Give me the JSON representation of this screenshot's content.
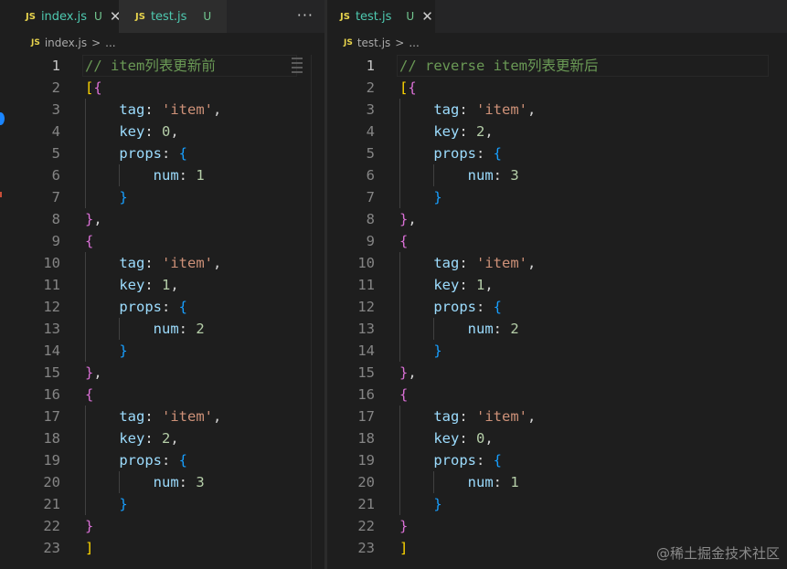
{
  "left": {
    "tabs": [
      {
        "icon": "JS",
        "name": "index.js",
        "status": "U",
        "close": "✕"
      },
      {
        "icon": "JS",
        "name": "test.js",
        "status": "U"
      }
    ],
    "more": "···",
    "breadcrumb": {
      "icon": "JS",
      "file": "index.js",
      "sep": ">",
      "rest": "..."
    },
    "lines": [
      [
        [
          "c-comment",
          "// item列表更新前"
        ]
      ],
      [
        [
          "c-b1",
          "["
        ],
        [
          "c-b2",
          "{"
        ]
      ],
      [
        [
          "c-punc",
          "    "
        ],
        [
          "c-key",
          "tag"
        ],
        [
          "c-punc",
          ": "
        ],
        [
          "c-str",
          "'item'"
        ],
        [
          "c-punc",
          ","
        ]
      ],
      [
        [
          "c-punc",
          "    "
        ],
        [
          "c-key",
          "key"
        ],
        [
          "c-punc",
          ": "
        ],
        [
          "c-num",
          "0"
        ],
        [
          "c-punc",
          ","
        ]
      ],
      [
        [
          "c-punc",
          "    "
        ],
        [
          "c-key",
          "props"
        ],
        [
          "c-punc",
          ": "
        ],
        [
          "c-b3",
          "{"
        ]
      ],
      [
        [
          "c-punc",
          "        "
        ],
        [
          "c-key",
          "num"
        ],
        [
          "c-punc",
          ": "
        ],
        [
          "c-num",
          "1"
        ]
      ],
      [
        [
          "c-punc",
          "    "
        ],
        [
          "c-b3",
          "}"
        ]
      ],
      [
        [
          "c-b2",
          "}"
        ],
        [
          "c-punc",
          ","
        ]
      ],
      [
        [
          "c-b2",
          "{"
        ]
      ],
      [
        [
          "c-punc",
          "    "
        ],
        [
          "c-key",
          "tag"
        ],
        [
          "c-punc",
          ": "
        ],
        [
          "c-str",
          "'item'"
        ],
        [
          "c-punc",
          ","
        ]
      ],
      [
        [
          "c-punc",
          "    "
        ],
        [
          "c-key",
          "key"
        ],
        [
          "c-punc",
          ": "
        ],
        [
          "c-num",
          "1"
        ],
        [
          "c-punc",
          ","
        ]
      ],
      [
        [
          "c-punc",
          "    "
        ],
        [
          "c-key",
          "props"
        ],
        [
          "c-punc",
          ": "
        ],
        [
          "c-b3",
          "{"
        ]
      ],
      [
        [
          "c-punc",
          "        "
        ],
        [
          "c-key",
          "num"
        ],
        [
          "c-punc",
          ": "
        ],
        [
          "c-num",
          "2"
        ]
      ],
      [
        [
          "c-punc",
          "    "
        ],
        [
          "c-b3",
          "}"
        ]
      ],
      [
        [
          "c-b2",
          "}"
        ],
        [
          "c-punc",
          ","
        ]
      ],
      [
        [
          "c-b2",
          "{"
        ]
      ],
      [
        [
          "c-punc",
          "    "
        ],
        [
          "c-key",
          "tag"
        ],
        [
          "c-punc",
          ": "
        ],
        [
          "c-str",
          "'item'"
        ],
        [
          "c-punc",
          ","
        ]
      ],
      [
        [
          "c-punc",
          "    "
        ],
        [
          "c-key",
          "key"
        ],
        [
          "c-punc",
          ": "
        ],
        [
          "c-num",
          "2"
        ],
        [
          "c-punc",
          ","
        ]
      ],
      [
        [
          "c-punc",
          "    "
        ],
        [
          "c-key",
          "props"
        ],
        [
          "c-punc",
          ": "
        ],
        [
          "c-b3",
          "{"
        ]
      ],
      [
        [
          "c-punc",
          "        "
        ],
        [
          "c-key",
          "num"
        ],
        [
          "c-punc",
          ": "
        ],
        [
          "c-num",
          "3"
        ]
      ],
      [
        [
          "c-punc",
          "    "
        ],
        [
          "c-b3",
          "}"
        ]
      ],
      [
        [
          "c-b2",
          "}"
        ]
      ],
      [
        [
          "c-b1",
          "]"
        ]
      ]
    ]
  },
  "right": {
    "tabs": [
      {
        "icon": "JS",
        "name": "test.js",
        "status": "U",
        "close": "✕"
      }
    ],
    "breadcrumb": {
      "icon": "JS",
      "file": "test.js",
      "sep": ">",
      "rest": "..."
    },
    "lines": [
      [
        [
          "c-comment",
          "// reverse item列表更新后"
        ]
      ],
      [
        [
          "c-b1",
          "["
        ],
        [
          "c-b2",
          "{"
        ]
      ],
      [
        [
          "c-punc",
          "    "
        ],
        [
          "c-key",
          "tag"
        ],
        [
          "c-punc",
          ": "
        ],
        [
          "c-str",
          "'item'"
        ],
        [
          "c-punc",
          ","
        ]
      ],
      [
        [
          "c-punc",
          "    "
        ],
        [
          "c-key",
          "key"
        ],
        [
          "c-punc",
          ": "
        ],
        [
          "c-num",
          "2"
        ],
        [
          "c-punc",
          ","
        ]
      ],
      [
        [
          "c-punc",
          "    "
        ],
        [
          "c-key",
          "props"
        ],
        [
          "c-punc",
          ": "
        ],
        [
          "c-b3",
          "{"
        ]
      ],
      [
        [
          "c-punc",
          "        "
        ],
        [
          "c-key",
          "num"
        ],
        [
          "c-punc",
          ": "
        ],
        [
          "c-num",
          "3"
        ]
      ],
      [
        [
          "c-punc",
          "    "
        ],
        [
          "c-b3",
          "}"
        ]
      ],
      [
        [
          "c-b2",
          "}"
        ],
        [
          "c-punc",
          ","
        ]
      ],
      [
        [
          "c-b2",
          "{"
        ]
      ],
      [
        [
          "c-punc",
          "    "
        ],
        [
          "c-key",
          "tag"
        ],
        [
          "c-punc",
          ": "
        ],
        [
          "c-str",
          "'item'"
        ],
        [
          "c-punc",
          ","
        ]
      ],
      [
        [
          "c-punc",
          "    "
        ],
        [
          "c-key",
          "key"
        ],
        [
          "c-punc",
          ": "
        ],
        [
          "c-num",
          "1"
        ],
        [
          "c-punc",
          ","
        ]
      ],
      [
        [
          "c-punc",
          "    "
        ],
        [
          "c-key",
          "props"
        ],
        [
          "c-punc",
          ": "
        ],
        [
          "c-b3",
          "{"
        ]
      ],
      [
        [
          "c-punc",
          "        "
        ],
        [
          "c-key",
          "num"
        ],
        [
          "c-punc",
          ": "
        ],
        [
          "c-num",
          "2"
        ]
      ],
      [
        [
          "c-punc",
          "    "
        ],
        [
          "c-b3",
          "}"
        ]
      ],
      [
        [
          "c-b2",
          "}"
        ],
        [
          "c-punc",
          ","
        ]
      ],
      [
        [
          "c-b2",
          "{"
        ]
      ],
      [
        [
          "c-punc",
          "    "
        ],
        [
          "c-key",
          "tag"
        ],
        [
          "c-punc",
          ": "
        ],
        [
          "c-str",
          "'item'"
        ],
        [
          "c-punc",
          ","
        ]
      ],
      [
        [
          "c-punc",
          "    "
        ],
        [
          "c-key",
          "key"
        ],
        [
          "c-punc",
          ": "
        ],
        [
          "c-num",
          "0"
        ],
        [
          "c-punc",
          ","
        ]
      ],
      [
        [
          "c-punc",
          "    "
        ],
        [
          "c-key",
          "props"
        ],
        [
          "c-punc",
          ": "
        ],
        [
          "c-b3",
          "{"
        ]
      ],
      [
        [
          "c-punc",
          "        "
        ],
        [
          "c-key",
          "num"
        ],
        [
          "c-punc",
          ": "
        ],
        [
          "c-num",
          "1"
        ]
      ],
      [
        [
          "c-punc",
          "    "
        ],
        [
          "c-b3",
          "}"
        ]
      ],
      [
        [
          "c-b2",
          "}"
        ]
      ],
      [
        [
          "c-b1",
          "]"
        ]
      ]
    ]
  },
  "watermark": "@稀土掘金技术社区",
  "colors": {
    "comment": "#6a9955",
    "bracket_gold": "#ffd700",
    "bracket_purple": "#da70d6",
    "bracket_blue": "#179fff",
    "property": "#9cdcfe",
    "string": "#ce9178",
    "number": "#b5cea8"
  }
}
